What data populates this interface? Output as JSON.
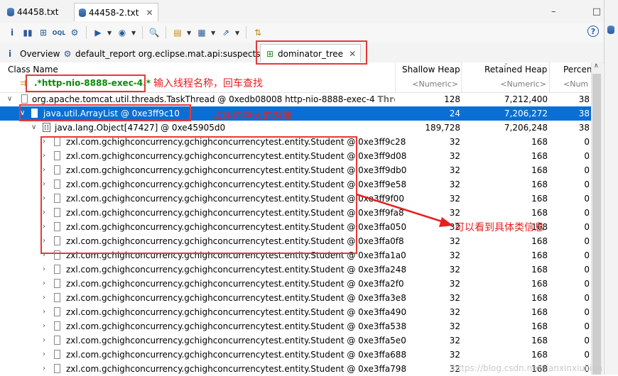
{
  "editor_tabs": [
    "44458.txt",
    "44458-2.txt"
  ],
  "window_buttons": {
    "minimize": "–",
    "maximize": "□"
  },
  "toolbar": {
    "buttons": [
      "info-icon",
      "histogram-icon",
      "dominator-icon",
      "oql-icon",
      "heap-dump-overview-icon",
      "run-report-icon",
      "query-browser-icon",
      "search-icon",
      "group-icon",
      "calculate-icon",
      "export-icon",
      "compare-icon"
    ],
    "help_label": "?"
  },
  "result_tabs": [
    {
      "label": "i",
      "icon": "info-icon"
    },
    {
      "label": "Overview"
    },
    {
      "label": "default_report  org.eclipse.mat.api:suspects"
    },
    {
      "label": "dominator_tree"
    }
  ],
  "columns": [
    {
      "name": "Class Name",
      "sub": ".*http-nio-8888-exec-4.*"
    },
    {
      "name": "Shallow Heap",
      "sub": "<Numeric>"
    },
    {
      "name": "Retained Heap",
      "sub": "<Numeric>"
    },
    {
      "name": "Percen",
      "sub": "<Num"
    }
  ],
  "rows": [
    {
      "name": "org.apache.tomcat.util.threads.TaskThread @ 0xedb08008  http-nio-8888-exec-4 ",
      "extra": "Threa",
      "shallow": "128",
      "retained": "7,212,400",
      "pct": "38"
    },
    {
      "name": "java.util.ArrayList @ 0xe3ff9c10",
      "shallow": "24",
      "retained": "7,206,272",
      "pct": "38"
    },
    {
      "name": "java.lang.Object[47427] @ 0xe45905d0",
      "shallow": "189,728",
      "retained": "7,206,248",
      "pct": "38"
    },
    {
      "name": "zxl.com.gchighconcurrency.gchighconcurrencytest.entity.Student @ 0xe3ff9c28",
      "shallow": "32",
      "retained": "168",
      "pct": "0"
    },
    {
      "name": "zxl.com.gchighconcurrency.gchighconcurrencytest.entity.Student @ 0xe3ff9d08",
      "shallow": "32",
      "retained": "168",
      "pct": "0"
    },
    {
      "name": "zxl.com.gchighconcurrency.gchighconcurrencytest.entity.Student @ 0xe3ff9db0",
      "shallow": "32",
      "retained": "168",
      "pct": "0"
    },
    {
      "name": "zxl.com.gchighconcurrency.gchighconcurrencytest.entity.Student @ 0xe3ff9e58",
      "shallow": "32",
      "retained": "168",
      "pct": "0"
    },
    {
      "name": "zxl.com.gchighconcurrency.gchighconcurrencytest.entity.Student @ 0xe3ff9f00",
      "shallow": "32",
      "retained": "168",
      "pct": "0"
    },
    {
      "name": "zxl.com.gchighconcurrency.gchighconcurrencytest.entity.Student @ 0xe3ff9fa8",
      "shallow": "32",
      "retained": "168",
      "pct": "0"
    },
    {
      "name": "zxl.com.gchighconcurrency.gchighconcurrencytest.entity.Student @ 0xe3ffa050",
      "shallow": "32",
      "retained": "168",
      "pct": "0"
    },
    {
      "name": "zxl.com.gchighconcurrency.gchighconcurrencytest.entity.Student @ 0xe3ffa0f8",
      "shallow": "32",
      "retained": "168",
      "pct": "0"
    },
    {
      "name": "zxl.com.gchighconcurrency.gchighconcurrencytest.entity.Student @ 0xe3ffa1a0",
      "shallow": "32",
      "retained": "168",
      "pct": "0"
    },
    {
      "name": "zxl.com.gchighconcurrency.gchighconcurrencytest.entity.Student @ 0xe3ffa248",
      "shallow": "32",
      "retained": "168",
      "pct": "0"
    },
    {
      "name": "zxl.com.gchighconcurrency.gchighconcurrencytest.entity.Student @ 0xe3ffa2f0",
      "shallow": "32",
      "retained": "168",
      "pct": "0"
    },
    {
      "name": "zxl.com.gchighconcurrency.gchighconcurrencytest.entity.Student @ 0xe3ffa3e8",
      "shallow": "32",
      "retained": "168",
      "pct": "0"
    },
    {
      "name": "zxl.com.gchighconcurrency.gchighconcurrencytest.entity.Student @ 0xe3ffa490",
      "shallow": "32",
      "retained": "168",
      "pct": "0"
    },
    {
      "name": "zxl.com.gchighconcurrency.gchighconcurrencytest.entity.Student @ 0xe3ffa538",
      "shallow": "32",
      "retained": "168",
      "pct": "0"
    },
    {
      "name": "zxl.com.gchighconcurrency.gchighconcurrencytest.entity.Student @ 0xe3ffa5e0",
      "shallow": "32",
      "retained": "168",
      "pct": "0"
    },
    {
      "name": "zxl.com.gchighconcurrency.gchighconcurrencytest.entity.Student @ 0xe3ffa688",
      "shallow": "32",
      "retained": "168",
      "pct": "0"
    },
    {
      "name": "zxl.com.gchighconcurrency.gchighconcurrencytest.entity.Student @ 0xe3ffa798",
      "shallow": "32",
      "retained": "168",
      "pct": "0"
    }
  ],
  "annotations": {
    "filter_hint": "输入线程名称，回车查找",
    "large_object": "占用内存大的对象",
    "class_info": "可以看到具体类信息",
    "annotation_color": "#e82020"
  },
  "selection_color": "#0a6fd4",
  "watermark": "https://blog.csdn.net/jianxinxiuliian"
}
